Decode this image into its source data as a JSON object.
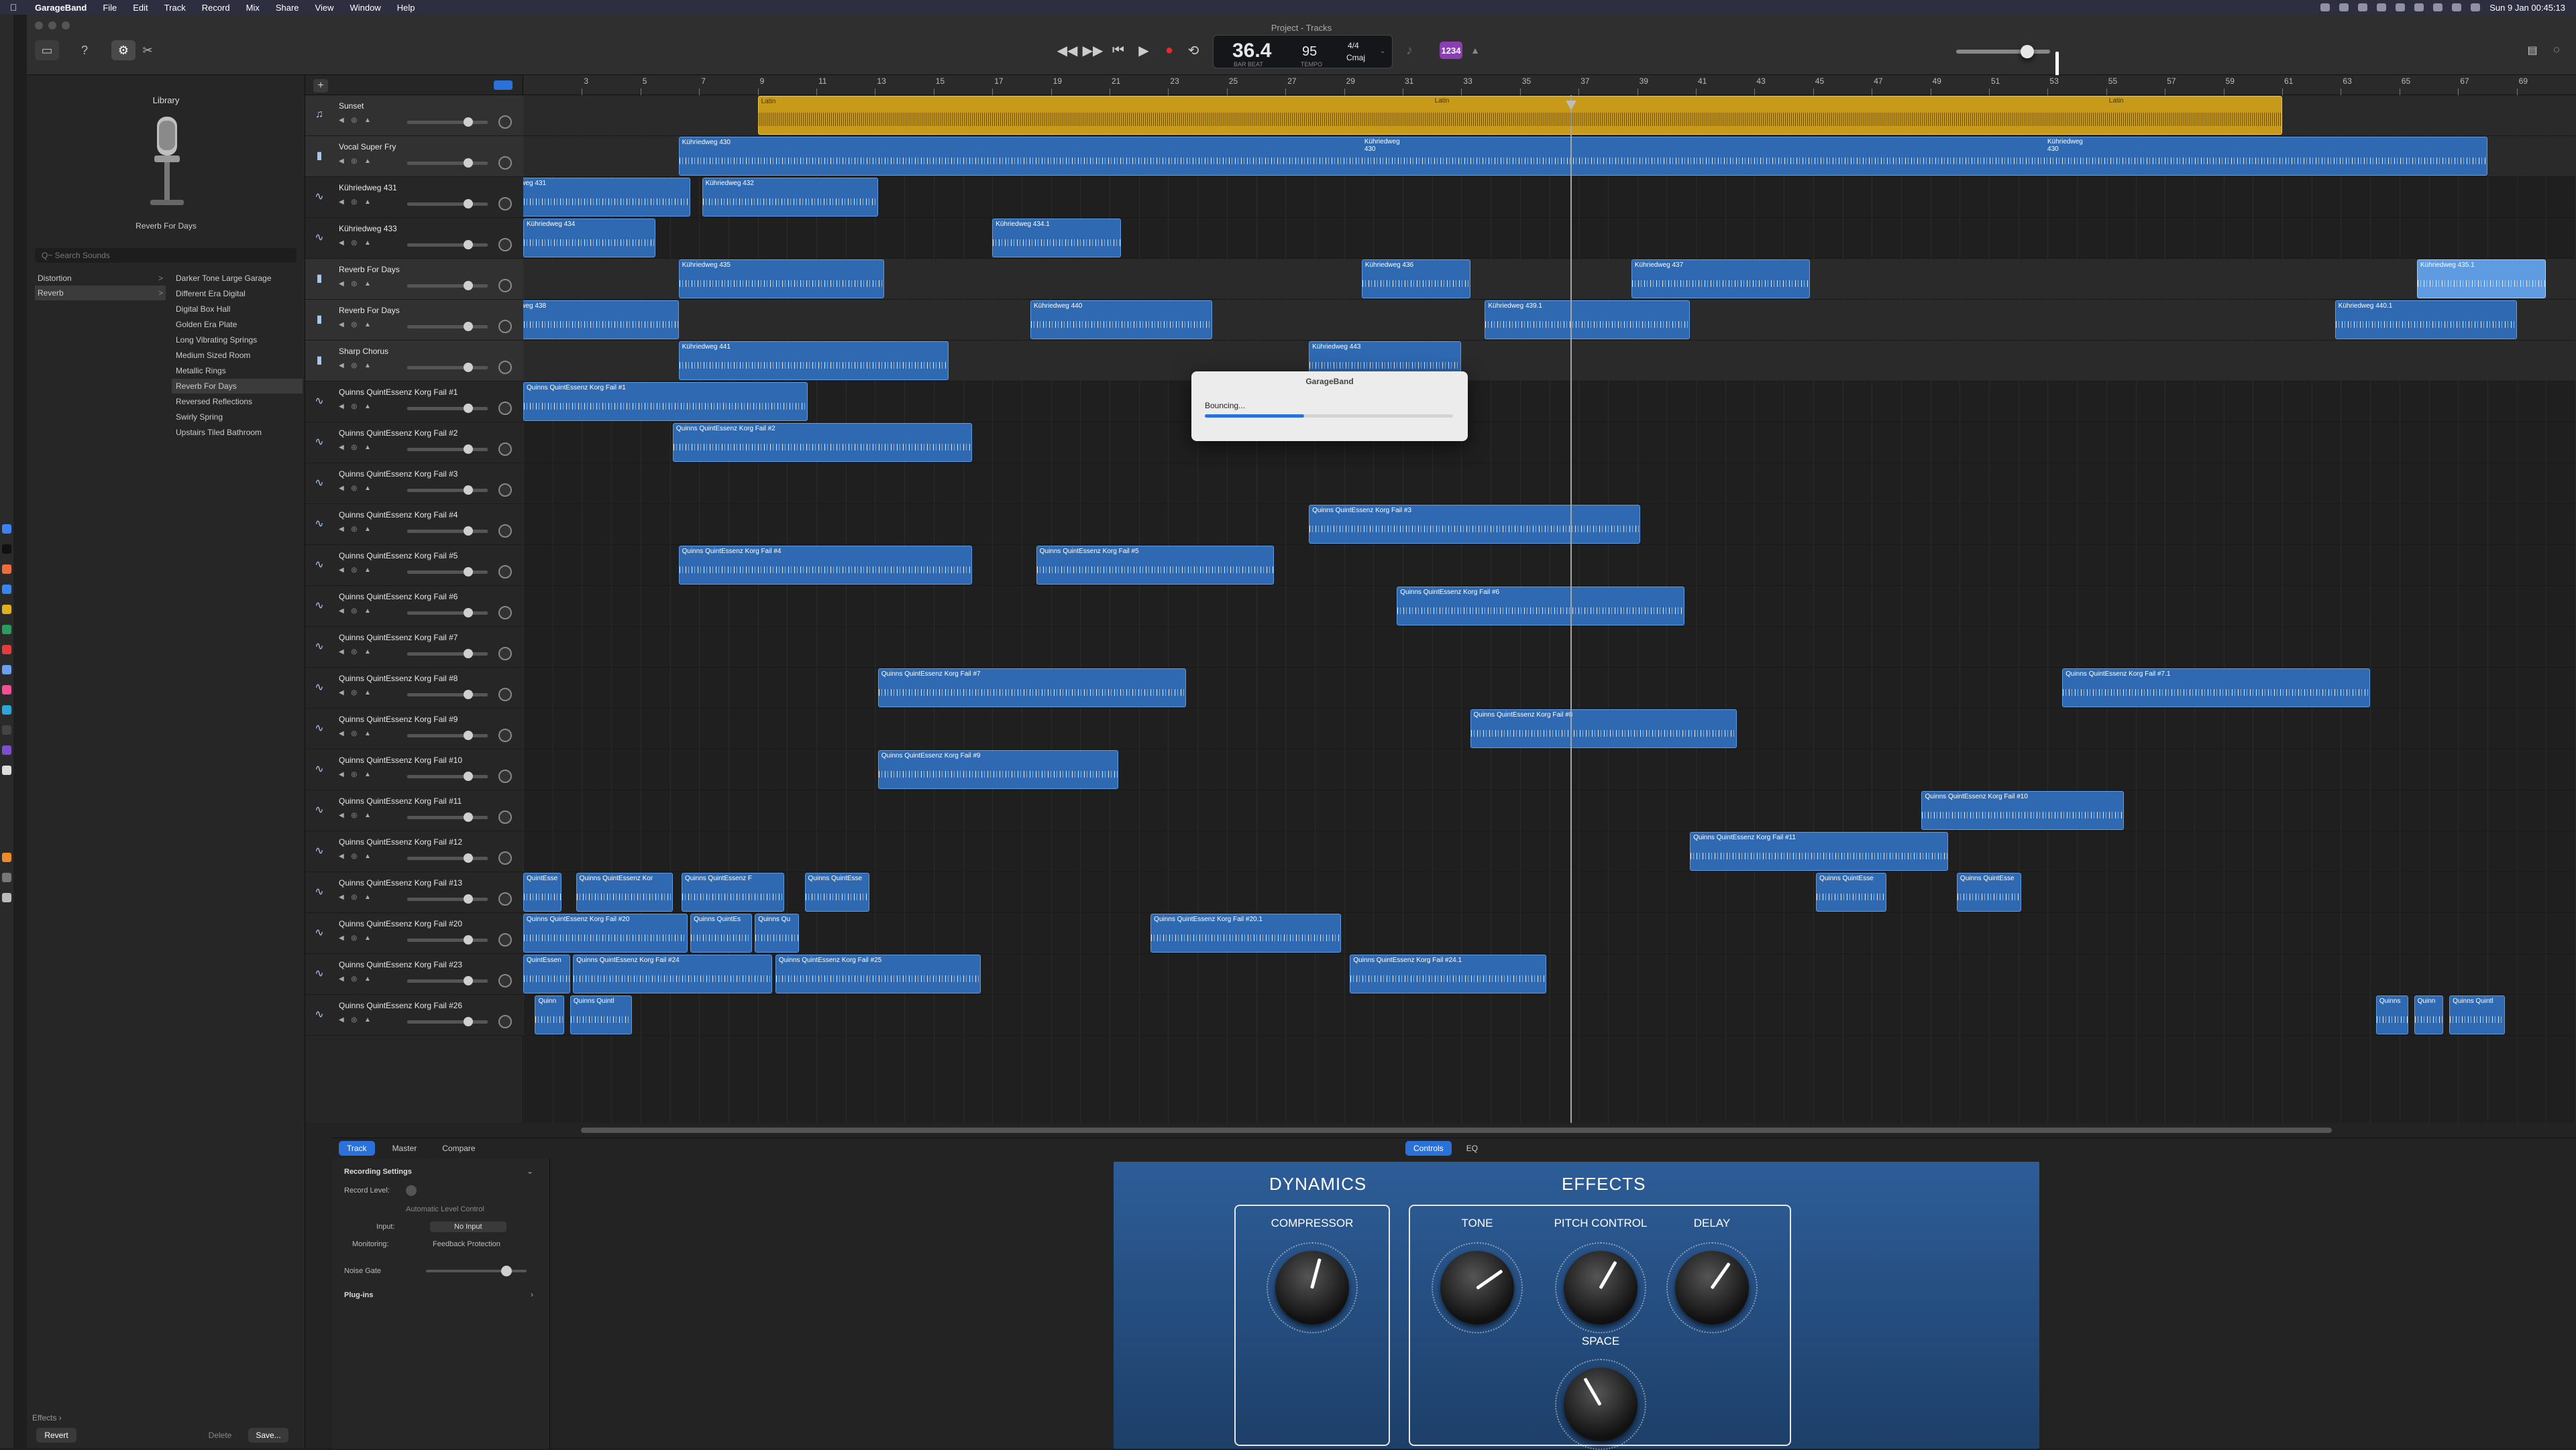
{
  "menubar": {
    "app_name": "GarageBand",
    "items": [
      "File",
      "Edit",
      "Track",
      "Record",
      "Mix",
      "Share",
      "View",
      "Window",
      "Help"
    ],
    "clock": "Sun 9 Jan 00:45:13"
  },
  "window": {
    "title": "Project - Tracks"
  },
  "lcd": {
    "position": "36.4",
    "position_sub": "BAR BEAT",
    "tempo": "95",
    "tempo_sub": "TEMPO",
    "signature": "4/4",
    "key": "Cmaj"
  },
  "count_in": "1234",
  "library": {
    "title": "Library",
    "preset": "Reverb For Days",
    "search_placeholder": "Q~ Search Sounds",
    "categories": [
      {
        "label": "Distortion",
        "arrow": ">"
      },
      {
        "label": "Reverb",
        "arrow": ">"
      }
    ],
    "items": [
      "Darker Tone Large Garage",
      "Different Era Digital",
      "Digital Box Hall",
      "Golden Era Plate",
      "Long Vibrating Springs",
      "Medium Sized Room",
      "Metallic Rings",
      "Reverb For Days",
      "Reversed Reflections",
      "Swirly Spring",
      "Upstairs Tiled Bathroom"
    ],
    "effects_label": "Effects ›",
    "revert": "Revert",
    "delete": "Delete",
    "save": "Save..."
  },
  "tracks": [
    "Sunset",
    "Vocal Super Fry",
    "Kühriedweg 431",
    "Kühriedweg 433",
    "Reverb For Days",
    "Reverb For Days",
    "Sharp Chorus",
    "Quinns QuintEssenz Korg Fail #1",
    "Quinns QuintEssenz Korg Fail #2",
    "Quinns QuintEssenz Korg Fail #3",
    "Quinns QuintEssenz Korg Fail #4",
    "Quinns QuintEssenz Korg Fail #5",
    "Quinns QuintEssenz Korg Fail #6",
    "Quinns QuintEssenz Korg Fail #7",
    "Quinns QuintEssenz Korg Fail #8",
    "Quinns QuintEssenz Korg Fail #9",
    "Quinns QuintEssenz Korg Fail #10",
    "Quinns QuintEssenz Korg Fail #11",
    "Quinns QuintEssenz Korg Fail #12",
    "Quinns QuintEssenz Korg Fail #13",
    "Quinns QuintEssenz Korg Fail #20",
    "Quinns QuintEssenz Korg Fail #23",
    "Quinns QuintEssenz Korg Fail #26"
  ],
  "ruler_ticks": [
    "3",
    "5",
    "7",
    "9",
    "11",
    "13",
    "15",
    "17",
    "19",
    "21",
    "23",
    "25",
    "27",
    "29",
    "31",
    "33",
    "35",
    "37",
    "39",
    "41",
    "43",
    "45",
    "47",
    "49",
    "51",
    "53",
    "55",
    "57",
    "59",
    "61",
    "63",
    "65",
    "67",
    "69"
  ],
  "regions": [
    {
      "label": "Latin",
      "track": 0,
      "start": 9,
      "end": 61,
      "style": "gold"
    },
    {
      "label": "Latin",
      "track": 0,
      "start": 32,
      "end": 33,
      "style": "none"
    },
    {
      "label": "Latin",
      "track": 0,
      "start": 55,
      "end": 56,
      "style": "none"
    },
    {
      "label": "Kühriedweg 430",
      "track": 1,
      "start": 6.3,
      "end": 68,
      "style": "blue"
    },
    {
      "label": "Kühriedweg 430",
      "track": 1,
      "start": 29.6,
      "end": 30.6,
      "style": "none"
    },
    {
      "label": "Kühriedweg 430",
      "track": 1,
      "start": 52.9,
      "end": 53.9,
      "style": "none"
    },
    {
      "label": "weg 431",
      "track": 2,
      "start": 0.8,
      "end": 6.7,
      "style": "blue"
    },
    {
      "label": "Kühriedweg 432",
      "track": 2,
      "start": 7.1,
      "end": 13.1,
      "style": "blue"
    },
    {
      "label": "Kühriedweg 434",
      "track": 3,
      "start": 1,
      "end": 5.5,
      "style": "blue"
    },
    {
      "label": "Kühriedweg 434.1",
      "track": 3,
      "start": 17,
      "end": 21.4,
      "style": "blue"
    },
    {
      "label": "Kühriedweg 435",
      "track": 4,
      "start": 6.3,
      "end": 13.3,
      "style": "blue"
    },
    {
      "label": "Kühriedweg 436",
      "track": 4,
      "start": 29.6,
      "end": 33.3,
      "style": "blue"
    },
    {
      "label": "Kühriedweg 437",
      "track": 4,
      "start": 38.8,
      "end": 44.9,
      "style": "blue"
    },
    {
      "label": "Kühriedweg 435.1",
      "track": 4,
      "start": 65.6,
      "end": 70,
      "style": "light"
    },
    {
      "label": "weg 438",
      "track": 5,
      "start": 0.8,
      "end": 6.3,
      "style": "blue"
    },
    {
      "label": "Kühriedweg 440",
      "track": 5,
      "start": 18.3,
      "end": 24.5,
      "style": "blue"
    },
    {
      "label": "Kühriedweg 439.1",
      "track": 5,
      "start": 33.8,
      "end": 40.8,
      "style": "blue"
    },
    {
      "label": "Kühriedweg 440.1",
      "track": 5,
      "start": 62.8,
      "end": 69,
      "style": "blue"
    },
    {
      "label": "Kühriedweg 441",
      "track": 6,
      "start": 6.3,
      "end": 15.5,
      "style": "blue"
    },
    {
      "label": "Kühriedweg 443",
      "track": 6,
      "start": 27.8,
      "end": 33,
      "style": "blue"
    },
    {
      "label": "Quinns QuintEssenz Korg Fail #1",
      "track": 7,
      "start": 1,
      "end": 10.7,
      "style": "blue"
    },
    {
      "label": "Quinns QuintEssenz Korg Fail #2",
      "track": 8,
      "start": 6.1,
      "end": 16.3,
      "style": "blue"
    },
    {
      "label": "Quinns QuintEssenz Korg Fail #3",
      "track": 10,
      "start": 27.8,
      "end": 39.1,
      "style": "blue"
    },
    {
      "label": "Quinns QuintEssenz Korg Fail #4",
      "track": 11,
      "start": 6.3,
      "end": 16.3,
      "style": "blue"
    },
    {
      "label": "Quinns QuintEssenz Korg Fail #5",
      "track": 11,
      "start": 18.5,
      "end": 26.6,
      "style": "blue"
    },
    {
      "label": "Quinns QuintEssenz Korg Fail #6",
      "track": 12,
      "start": 30.8,
      "end": 40.6,
      "style": "blue"
    },
    {
      "label": "Quinns QuintEssenz Korg Fail #7",
      "track": 14,
      "start": 13.1,
      "end": 23.6,
      "style": "blue"
    },
    {
      "label": "Quinns QuintEssenz Korg Fail #7.1",
      "track": 14,
      "start": 53.5,
      "end": 64,
      "style": "blue"
    },
    {
      "label": "Quinns QuintEssenz Korg Fail #8",
      "track": 15,
      "start": 33.3,
      "end": 42.4,
      "style": "blue"
    },
    {
      "label": "Quinns QuintEssenz Korg Fail #9",
      "track": 16,
      "start": 13.1,
      "end": 21.3,
      "style": "blue"
    },
    {
      "label": "Quinns QuintEssenz Korg Fail #10",
      "track": 17,
      "start": 48.7,
      "end": 55.6,
      "style": "blue"
    },
    {
      "label": "Quinns QuintEssenz Korg Fail #11",
      "track": 18,
      "start": 40.8,
      "end": 49.6,
      "style": "blue"
    },
    {
      "label": "QuintEsse",
      "track": 19,
      "start": 1,
      "end": 2.3,
      "style": "blue"
    },
    {
      "label": "Quinns QuintEssenz Kor",
      "track": 19,
      "start": 2.8,
      "end": 6.1,
      "style": "blue"
    },
    {
      "label": "Quinns QuintEssenz F",
      "track": 19,
      "start": 6.4,
      "end": 9.9,
      "style": "blue"
    },
    {
      "label": "Quinns QuintEsse",
      "track": 19,
      "start": 10.6,
      "end": 12.8,
      "style": "blue"
    },
    {
      "label": "Quinns QuintEsse",
      "track": 19,
      "start": 45.1,
      "end": 47.5,
      "style": "blue"
    },
    {
      "label": "Quinns QuintEsse",
      "track": 19,
      "start": 49.9,
      "end": 52.1,
      "style": "blue"
    },
    {
      "label": "Quinns QuintEssenz Korg Fail #20",
      "track": 20,
      "start": 1,
      "end": 6.6,
      "style": "blue"
    },
    {
      "label": "Quinns QuintEs",
      "track": 20,
      "start": 6.7,
      "end": 8.8,
      "style": "blue"
    },
    {
      "label": "Quinns Qu",
      "track": 20,
      "start": 8.9,
      "end": 10.4,
      "style": "blue"
    },
    {
      "label": "Quinns QuintEssenz Korg Fail #20.1",
      "track": 20,
      "start": 22.4,
      "end": 28.9,
      "style": "blue"
    },
    {
      "label": "QuintEssen",
      "track": 21,
      "start": 1,
      "end": 2.6,
      "style": "blue"
    },
    {
      "label": "Quinns QuintEssenz Korg Fail #24",
      "track": 21,
      "start": 2.7,
      "end": 9.5,
      "style": "blue"
    },
    {
      "label": "Quinns QuintEssenz Korg Fail #25",
      "track": 21,
      "start": 9.6,
      "end": 16.6,
      "style": "blue"
    },
    {
      "label": "Quinns QuintEssenz Korg Fail #24.1",
      "track": 21,
      "start": 29.2,
      "end": 35.9,
      "style": "blue"
    },
    {
      "label": "Quinn",
      "track": 22,
      "start": 1.4,
      "end": 2.4,
      "style": "blue"
    },
    {
      "label": "Quinns Quintl",
      "track": 22,
      "start": 2.6,
      "end": 4.7,
      "style": "blue"
    },
    {
      "label": "Quinns",
      "track": 22,
      "start": 64.2,
      "end": 65.3,
      "style": "blue"
    },
    {
      "label": "Quinn",
      "track": 22,
      "start": 65.5,
      "end": 66.5,
      "style": "blue"
    },
    {
      "label": "Quinns Quintl",
      "track": 22,
      "start": 66.7,
      "end": 68.6,
      "style": "blue"
    }
  ],
  "dialog": {
    "title": "GarageBand",
    "message": "Bouncing...",
    "progress": 0.4
  },
  "bottom": {
    "tabs": [
      "Track",
      "Master",
      "Compare"
    ],
    "control_tabs": [
      "Controls",
      "EQ"
    ],
    "inspector": {
      "recording_settings": "Recording Settings",
      "record_level": "Record Level:",
      "auto_level": "Automatic Level Control",
      "input_label": "Input:",
      "input_value": "No Input",
      "monitoring": "Monitoring:",
      "feedback": "Feedback Protection",
      "noise_gate": "Noise Gate",
      "plugins": "Plug-ins"
    },
    "smart": {
      "dynamics": "DYNAMICS",
      "effects": "EFFECTS",
      "compressor": "COMPRESSOR",
      "tone": "TONE",
      "pitch_control": "PITCH CONTROL",
      "delay": "DELAY",
      "space": "SPACE"
    }
  },
  "colors": {
    "region_blue": "#2f69b2",
    "region_gold": "#c79a1a",
    "accent": "#2a72d9",
    "smart_panel": "#2d5d98"
  }
}
